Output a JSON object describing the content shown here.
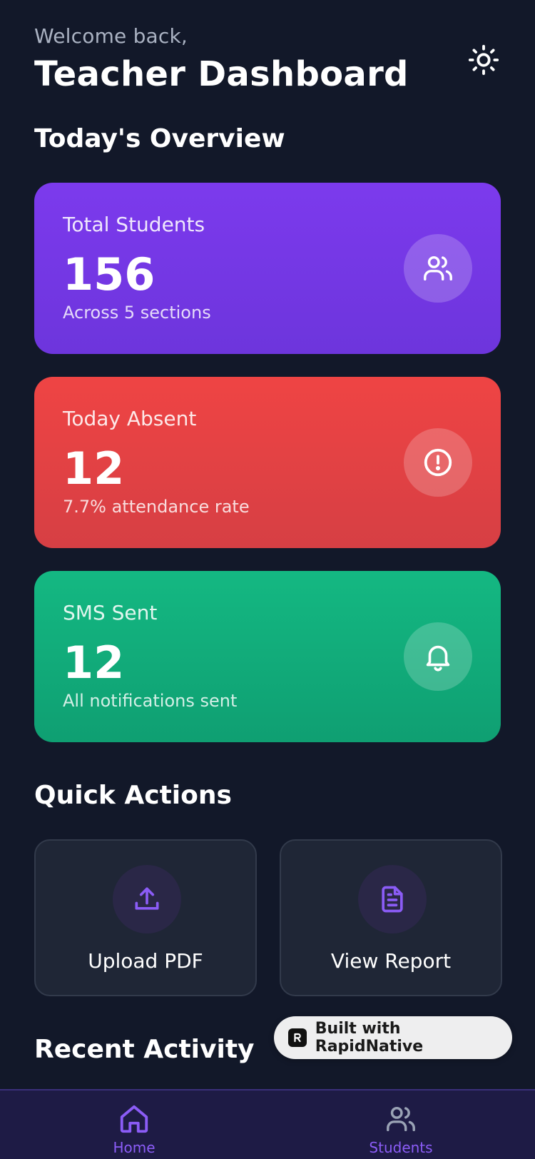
{
  "header": {
    "welcome": "Welcome back,",
    "title": "Teacher Dashboard",
    "theme_toggle_icon": "sun-icon"
  },
  "overview": {
    "title": "Today's Overview",
    "cards": [
      {
        "label": "Total Students",
        "value": "156",
        "sub": "Across 5 sections",
        "icon": "users-icon",
        "color": "#7c3aed"
      },
      {
        "label": "Today Absent",
        "value": "12",
        "sub": "7.7% attendance rate",
        "icon": "alert-circle-icon",
        "color": "#ef4444"
      },
      {
        "label": "SMS Sent",
        "value": "12",
        "sub": "All notifications sent",
        "icon": "bell-icon",
        "color": "#10b981"
      }
    ]
  },
  "quick_actions": {
    "title": "Quick Actions",
    "items": [
      {
        "label": "Upload PDF",
        "icon": "upload-icon"
      },
      {
        "label": "View Report",
        "icon": "file-text-icon"
      }
    ],
    "accent": "#8b5cf6"
  },
  "recent_activity": {
    "title": "Recent Activity"
  },
  "badge": {
    "text": "Built with RapidNative"
  },
  "tabbar": {
    "tabs": [
      {
        "label": "Home",
        "icon": "home-icon"
      },
      {
        "label": "Students",
        "icon": "users-icon"
      }
    ],
    "active_color": "#8b5cf6",
    "background": "#1e1b45"
  }
}
